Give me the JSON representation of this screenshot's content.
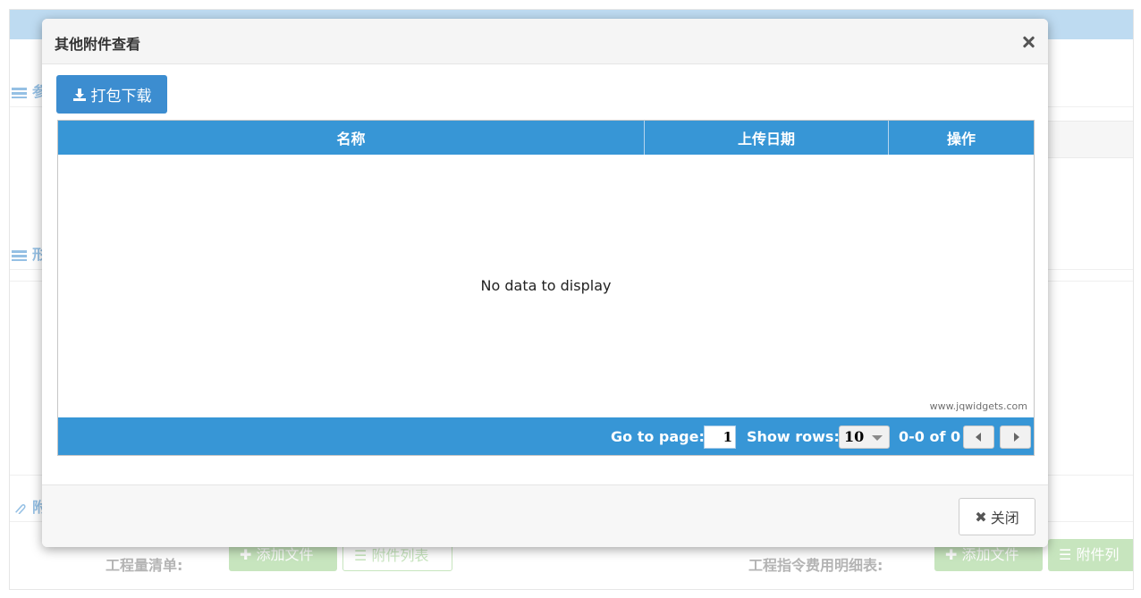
{
  "background": {
    "sections": [
      {
        "label": "参",
        "icon": "list-icon"
      },
      {
        "label": "形",
        "icon": "list-icon"
      },
      {
        "label": "附",
        "icon": "paperclip-icon"
      }
    ],
    "row_left_label": "工程量清单:",
    "row_right_label": "工程指令费用明细表:",
    "add_file_label": "添加文件",
    "attach_list_label": "附件列表",
    "attach_list_label_partial": "附件列"
  },
  "modal": {
    "title": "其他附件查看",
    "pack_download_label": "打包下载",
    "close_label": "关闭"
  },
  "grid": {
    "columns": [
      "名称",
      "上传日期",
      "操作"
    ],
    "empty_text": "No data to display",
    "watermark": "www.jqwidgets.com",
    "pager": {
      "go_to_page_label": "Go to page:",
      "page_value": "1",
      "show_rows_label": "Show rows:",
      "rows_value": "10",
      "range_text": "0-0 of 0"
    }
  },
  "colors": {
    "grid_header": "#3796d6",
    "primary_button": "#3c8dd0",
    "success_faded": "#a9d79b",
    "topbar": "#9cc8ea"
  }
}
